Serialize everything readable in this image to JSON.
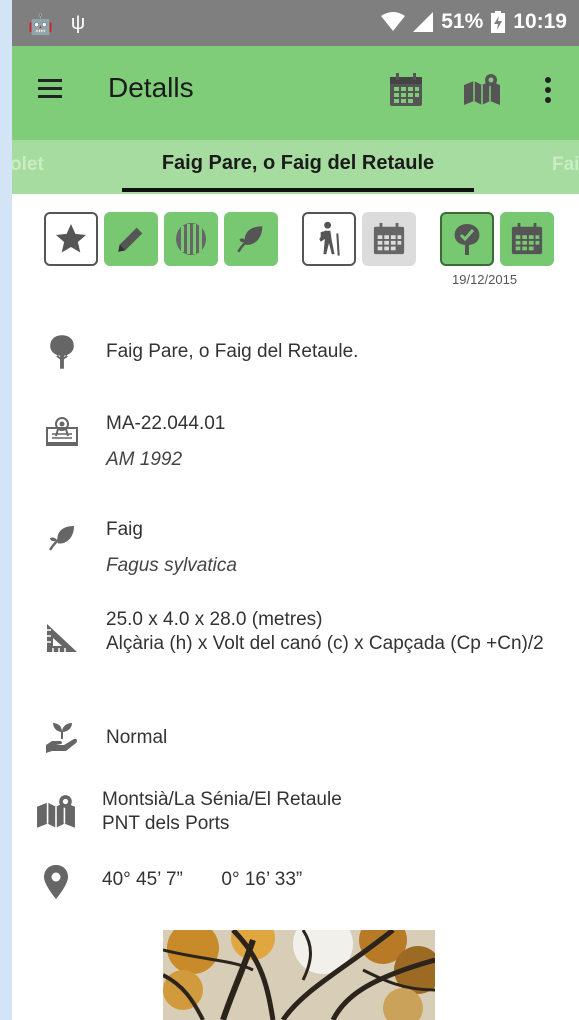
{
  "status_bar": {
    "battery": "51%",
    "time": "10:19"
  },
  "app_bar": {
    "title": "Detalls",
    "icons": [
      "menu-icon",
      "calendar-icon",
      "map-icon",
      "more-vert-icon"
    ]
  },
  "tabs": {
    "left": "olet",
    "active": "Faig Pare, o Faig del Retaule",
    "right": "Fai"
  },
  "actions": {
    "icons": [
      "star-icon",
      "pencil-icon",
      "catalonia-flag-icon",
      "leaf-icon",
      "hiker-icon",
      "calendar-icon",
      "tree-check-icon",
      "calendar-icon"
    ],
    "date": "19/12/2015"
  },
  "details": {
    "name": "Faig Pare, o Faig del Retaule.",
    "code": "MA-22.044.01",
    "code_sub": "AM 1992",
    "species_common": "Faig",
    "species_latin": "Fagus sylvatica",
    "measures": "25.0 x 4.0 x 28.0 (metres)",
    "measures_sub": "Alçària (h) x Volt del canó (c) x Capçada (Cp +Cn)/2",
    "state": "Normal",
    "location": "Montsià/La Sénia/El Retaule",
    "location_sub": "PNT dels Ports",
    "lat": "40° 45’ 7”",
    "lon": "0° 16’ 33”"
  },
  "colors": {
    "appbar": "#7fcd78",
    "tabs": "#a6dc9f",
    "statusbar": "#7f7f7f",
    "accent_green": "#78c872",
    "icon_grey": "#555555"
  }
}
